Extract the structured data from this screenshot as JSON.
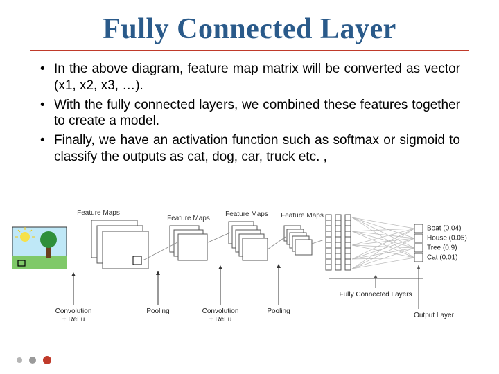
{
  "title": "Fully Connected Layer",
  "bullets": [
    "In the above diagram, feature map matrix will be converted as vector (x1, x2, x3, …).",
    "With the fully connected layers, we combined these features together to create a model.",
    " Finally, we have an activation function such as softmax or sigmoid to classify the outputs as cat, dog, car, truck etc. ,"
  ],
  "diagram": {
    "labels": {
      "feature_maps": "Feature Maps",
      "conv_relu_l1": "Convolution",
      "conv_relu_l2": "+ ReLu",
      "pooling": "Pooling",
      "fully_connected": "Fully Connected Layers",
      "output_layer": "Output Layer"
    },
    "outputs": [
      "Boat (0.04)",
      "House (0.05)",
      "Tree (0.9)",
      "Cat (0.01)"
    ]
  }
}
